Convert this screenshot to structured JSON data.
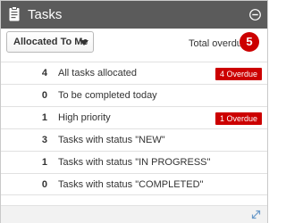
{
  "header": {
    "title": "Tasks",
    "icon": "clipboard-icon",
    "action_icon": "collapse-icon"
  },
  "toolbar": {
    "filter_selected": "Allocated To Me",
    "total_overdue_label": "Total overdue",
    "total_overdue_count": "5"
  },
  "rows": [
    {
      "count": "4",
      "label": "All tasks allocated",
      "badge": "4 Overdue"
    },
    {
      "count": "0",
      "label": "To be completed today",
      "badge": ""
    },
    {
      "count": "1",
      "label": "High priority",
      "badge": "1 Overdue"
    },
    {
      "count": "3",
      "label": "Tasks with status \"NEW\"",
      "badge": ""
    },
    {
      "count": "1",
      "label": "Tasks with status \"IN PROGRESS\"",
      "badge": ""
    },
    {
      "count": "0",
      "label": "Tasks with status \"COMPLETED\"",
      "badge": ""
    }
  ],
  "footer": {
    "icon": "expand-icon"
  },
  "colors": {
    "header_bg": "#5b5b5b",
    "alert_red": "#cc0000",
    "footer_bg": "#f2f2f2"
  }
}
